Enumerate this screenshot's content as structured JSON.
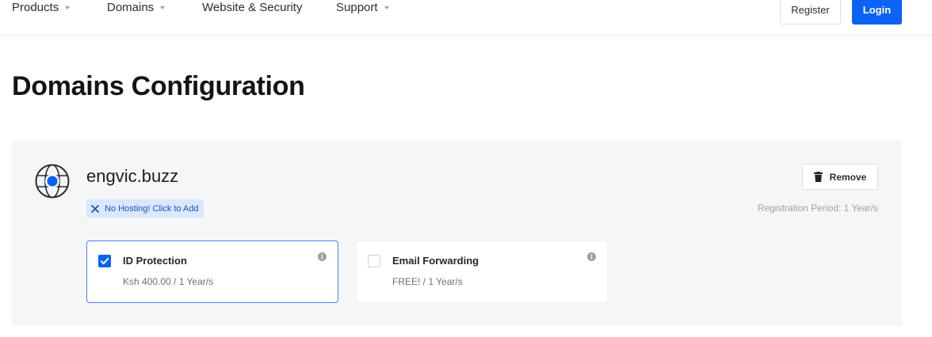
{
  "nav": {
    "products": "Products",
    "domains": "Domains",
    "website_security": "Website & Security",
    "support": "Support",
    "register": "Register",
    "login": "Login"
  },
  "page": {
    "title": "Domains Configuration"
  },
  "domain": {
    "name": "engvic.buzz",
    "hosting_badge": "No Hosting! Click to Add",
    "remove_label": "Remove",
    "registration_period": "Registration Period: 1 Year/s",
    "addons": [
      {
        "title": "ID Protection",
        "price": "Ksh 400.00 / 1 Year/s",
        "checked": true
      },
      {
        "title": "Email Forwarding",
        "price": "FREE! / 1 Year/s",
        "checked": false
      }
    ]
  },
  "colors": {
    "primary": "#0a63f5",
    "badge_bg": "#dbe8fb",
    "badge_text": "#1356c4",
    "card_bg": "#f5f6f7"
  },
  "icons": {
    "domain": "globe-icon",
    "hosting": "x-icon",
    "remove": "trash-icon",
    "addon_info": "info-icon"
  }
}
